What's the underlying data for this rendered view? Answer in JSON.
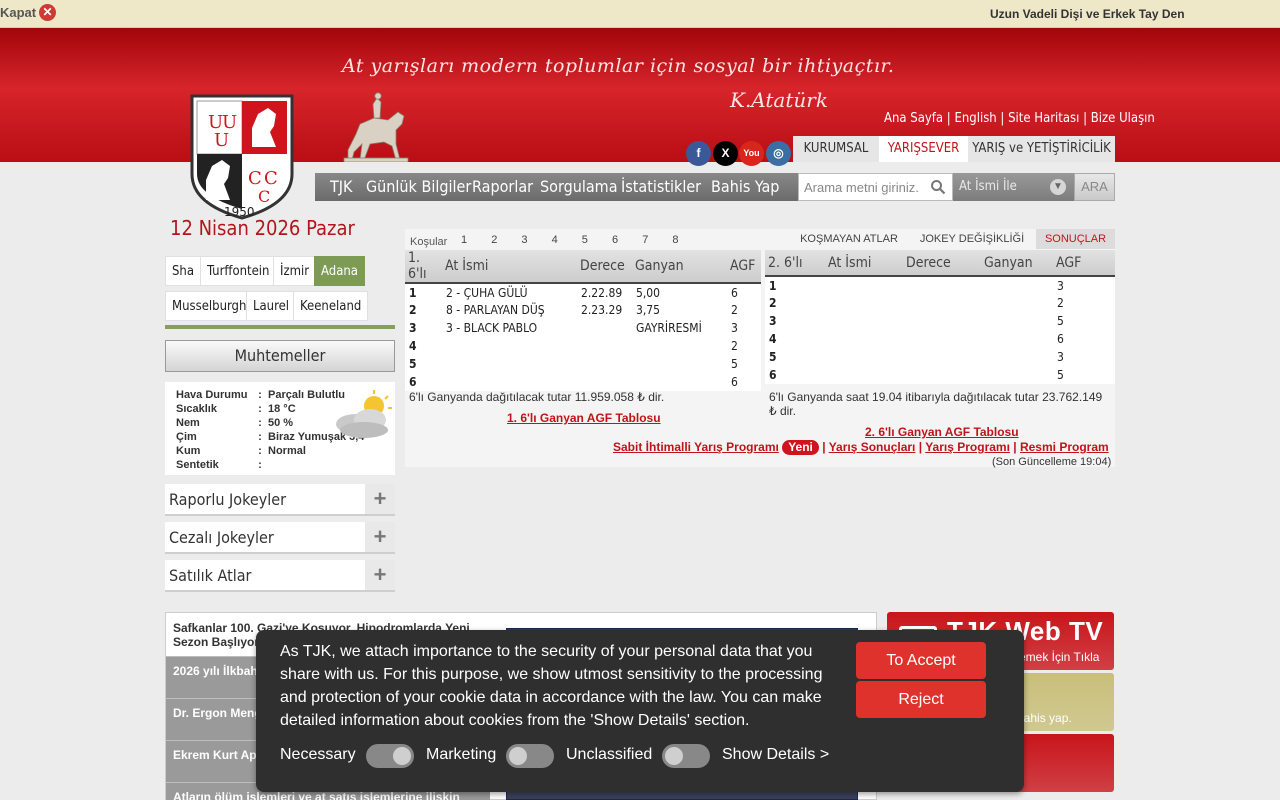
{
  "topbar": {
    "close_label": "Kapat",
    "close_icon": "close-icon",
    "ticker_text": "Uzun Vadeli Dişi ve Erkek Tay Dene"
  },
  "header": {
    "motto": "At yarışları modern toplumlar için sosyal bir ihtiyaçtır.",
    "signature": "K.Atatürk",
    "logo_year": "1950",
    "top_links": [
      "Ana Sayfa",
      "English",
      "Site Haritası",
      "Bize Ulaşın"
    ],
    "social": [
      {
        "name": "facebook-icon",
        "glyph": "f",
        "color": "#3b5998"
      },
      {
        "name": "x-icon",
        "glyph": "X",
        "color": "#000000"
      },
      {
        "name": "youtube-icon",
        "glyph": "You",
        "color": "#d9251c"
      },
      {
        "name": "instagram-icon",
        "glyph": "◎",
        "color": "#3a6ea5"
      }
    ],
    "site_tabs": [
      "KURUMSAL",
      "YARIŞSEVER",
      "YARIŞ ve YETİŞTİRİCİLİK"
    ],
    "active_site_tab": "YARIŞSEVER"
  },
  "nav": {
    "items": [
      "TJK",
      "Günlük Bilgiler",
      "Raporlar",
      "Sorgulama",
      "İstatistikler",
      "Bahis Yap"
    ],
    "search_placeholder": "Arama metni giriniz.",
    "search_type": "At İsmi İle",
    "search_button": "ARA"
  },
  "left": {
    "date": "12 Nisan 2026 Pazar",
    "cities": [
      "Sha",
      "Turffontein",
      "İzmir",
      "Adana",
      "Musselburgh",
      "Laurel",
      "Keeneland"
    ],
    "active_city": "Adana",
    "muhtemeller": "Muhtemeller",
    "weather": [
      {
        "k": "Hava Durumu",
        "v": "Parçalı Bulutlu"
      },
      {
        "k": "Sıcaklık",
        "v": "18 °C"
      },
      {
        "k": "Nem",
        "v": "50 %"
      },
      {
        "k": "Çim",
        "v": "Biraz Yumuşak 3,4"
      },
      {
        "k": "Kum",
        "v": "Normal"
      },
      {
        "k": "Sentetik",
        "v": ""
      }
    ],
    "accordions": [
      "Raporlu Jokeyler",
      "Cezalı Jokeyler",
      "Satılık Atlar"
    ]
  },
  "races": {
    "kosular_label": "Koşular",
    "race_numbers": [
      "1",
      "2",
      "3",
      "4",
      "5",
      "6",
      "7",
      "8"
    ],
    "tabs": [
      "KOŞMAYAN ATLAR",
      "JOKEY DEĞİŞİKLİĞİ",
      "SONUÇLAR"
    ],
    "active_tab": "SONUÇLAR",
    "table1": {
      "headers": [
        "1. 6'lı",
        "At İsmi",
        "Derece",
        "Ganyan",
        "AGF"
      ],
      "rows": [
        [
          "1",
          "2 - ÇUHA GÜLÜ",
          "2.22.89",
          "5,00",
          "6"
        ],
        [
          "2",
          "8 - PARLAYAN DÜŞ",
          "2.23.29",
          "3,75",
          "2"
        ],
        [
          "3",
          "3 - BLACK PABLO",
          "",
          "GAYRİRESMİ",
          "3"
        ],
        [
          "4",
          "",
          "",
          "",
          "2"
        ],
        [
          "5",
          "",
          "",
          "",
          "5"
        ],
        [
          "6",
          "",
          "",
          "",
          "6"
        ]
      ],
      "note": "6'lı Ganyanda dağıtılacak tutar 11.959.058 ₺ dir.",
      "agf_link": "1. 6'lı Ganyan AGF Tablosu"
    },
    "table2": {
      "headers": [
        "2. 6'lı",
        "At İsmi",
        "Derece",
        "Ganyan",
        "AGF"
      ],
      "rows": [
        [
          "1",
          "",
          "",
          "",
          "3"
        ],
        [
          "2",
          "",
          "",
          "",
          "2"
        ],
        [
          "3",
          "",
          "",
          "",
          "5"
        ],
        [
          "4",
          "",
          "",
          "",
          "6"
        ],
        [
          "5",
          "",
          "",
          "",
          "3"
        ],
        [
          "6",
          "",
          "",
          "",
          "5"
        ]
      ],
      "note": "6'lı Ganyanda saat 19.04 itibarıyla dağıtılacak tutar 23.762.149 ₺ dir.",
      "agf_link": "2. 6'lı Ganyan AGF Tablosu"
    },
    "links": {
      "sabit": "Sabit İhtimalli Yarış Programı",
      "yeni": "Yeni",
      "sonuclari": "Yarış Sonuçları",
      "programi": "Yarış Programı",
      "resmi": "Resmi Program"
    },
    "updated": "(Son Güncelleme 19:04)"
  },
  "news": [
    "Safkanlar 100. Gazi'ye Koşuyor, Hipodromlarda Yeni Sezon Başlıyor",
    "2026 yılı İlkbahar ... edildi",
    "Dr. Ergon Meng... Ammayaman c...",
    "Ekrem Kurt Ap... adayları için ön...",
    "Atların ölüm işlemleri ve at satış işlemlerine ilişkin"
  ],
  "promos": [
    {
      "title": "TJK Web TV",
      "sub": "İzlemek İçin Tıkla",
      "color": "#c8151b"
    },
    {
      "title": "...ap",
      "sub": "...bahis yap.",
      "color": "#c9bf7a"
    },
    {
      "title": "...lasa",
      "sub": "",
      "color": "#c8151b"
    }
  ],
  "cookie": {
    "text": "As TJK, we attach importance to the security of your personal data that you share with us. For this purpose, we show utmost sensitivity to the processing and protection of your cookie data in accordance with the law. You can make detailed information about cookies from the 'Show Details' section.",
    "accept": "To Accept",
    "reject": "Reject",
    "options": [
      "Necessary",
      "Marketing",
      "Unclassified"
    ],
    "show_details": "Show Details >"
  }
}
